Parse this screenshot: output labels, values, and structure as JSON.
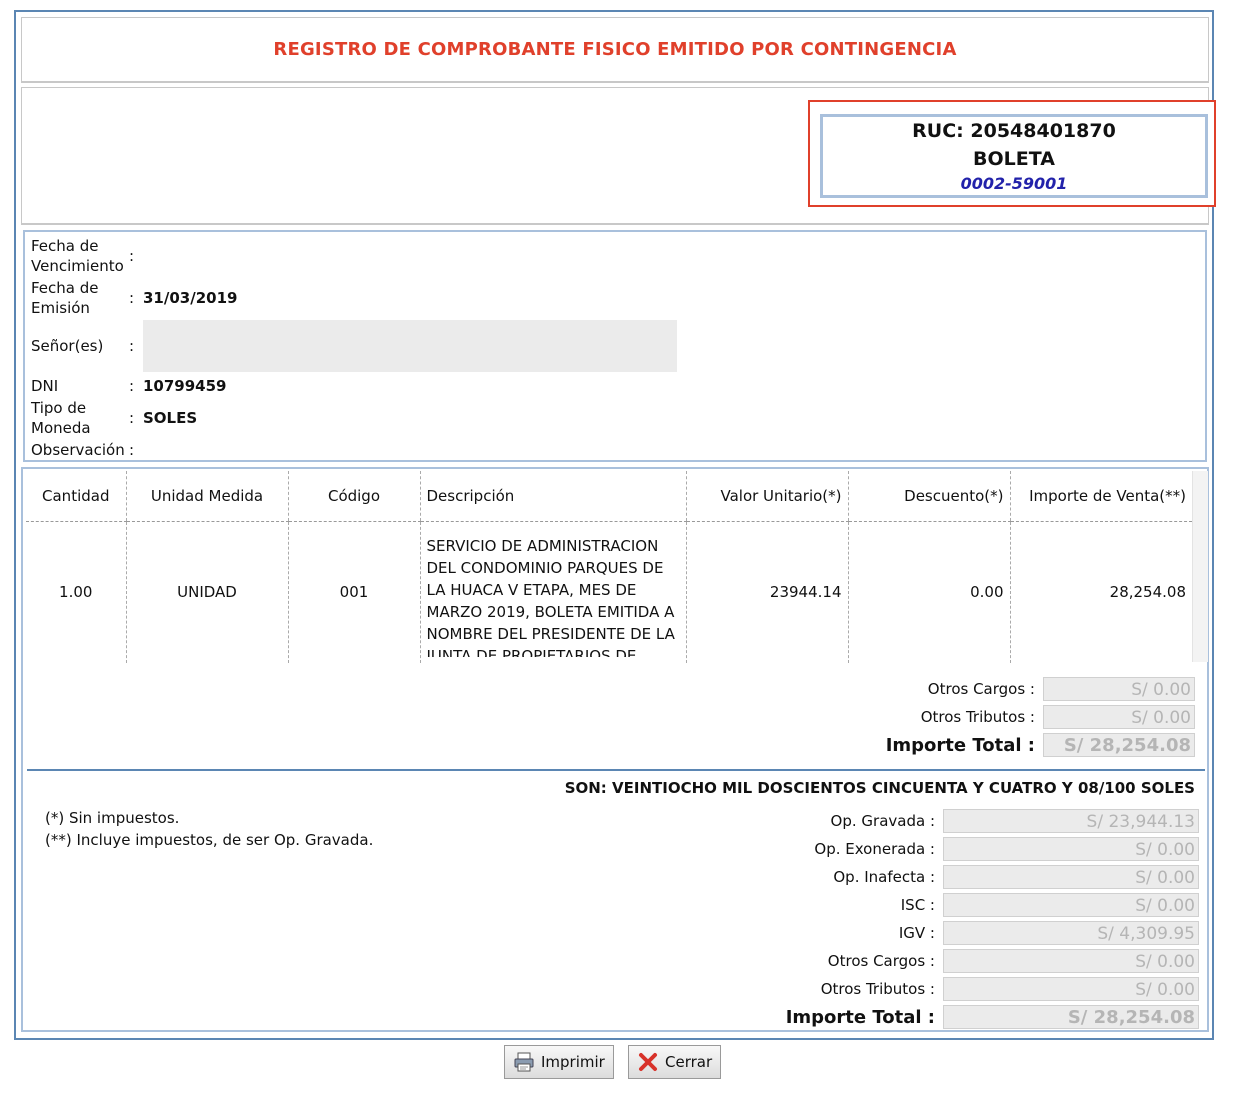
{
  "title": "REGISTRO DE COMPROBANTE FISICO EMITIDO POR CONTINGENCIA",
  "ruc_box": {
    "ruc": "RUC: 20548401870",
    "doc_type": "BOLETA",
    "number": "0002-59001"
  },
  "info": {
    "vencimiento_label": "Fecha de Vencimiento",
    "vencimiento_value": "",
    "emision_label": "Fecha de Emisión",
    "emision_value": "31/03/2019",
    "senor_label": "Señor(es)",
    "dni_label": "DNI",
    "dni_value": "10799459",
    "moneda_label": "Tipo de Moneda",
    "moneda_value": "SOLES",
    "observacion_label": "Observación",
    "colon": ":"
  },
  "table": {
    "headers": [
      "Cantidad",
      "Unidad Medida",
      "Código",
      "Descripción",
      "Valor Unitario(*)",
      "Descuento(*)",
      "Importe de Venta(**)"
    ],
    "rows": [
      {
        "cantidad": "1.00",
        "unidad": "UNIDAD",
        "codigo": "001",
        "descripcion": "SERVICIO DE ADMINISTRACION DEL CONDOMINIO PARQUES DE LA HUACA V ETAPA, MES DE MARZO 2019, BOLETA EMITIDA A NOMBRE DEL PRESIDENTE DE LA JUNTA DE PROPIETARIOS DE PARQUE DE LA HUACA V ETAPA",
        "valor_unitario": "23944.14",
        "descuento": "0.00",
        "importe": "28,254.08"
      }
    ]
  },
  "totals_top": {
    "otros_cargos_label": "Otros Cargos :",
    "otros_cargos_value": "S/ 0.00",
    "otros_tributos_label": "Otros Tributos :",
    "otros_tributos_value": "S/ 0.00",
    "importe_total_label": "Importe Total :",
    "importe_total_value": "S/ 28,254.08"
  },
  "son": "SON: VEINTIOCHO MIL DOSCIENTOS CINCUENTA Y CUATRO Y 08/100 SOLES",
  "notes": {
    "note1": "(*) Sin impuestos.",
    "note2": "(**) Incluye impuestos, de ser Op. Gravada."
  },
  "summary": [
    {
      "label": "Op. Gravada :",
      "value": "S/ 23,944.13"
    },
    {
      "label": "Op. Exonerada :",
      "value": "S/ 0.00"
    },
    {
      "label": "Op. Inafecta :",
      "value": "S/ 0.00"
    },
    {
      "label": "ISC :",
      "value": "S/ 0.00"
    },
    {
      "label": "IGV :",
      "value": "S/ 4,309.95"
    },
    {
      "label": "Otros Cargos :",
      "value": "S/ 0.00"
    },
    {
      "label": "Otros Tributos :",
      "value": "S/ 0.00"
    }
  ],
  "summary_total": {
    "label": "Importe Total :",
    "value": "S/ 28,254.08"
  },
  "buttons": {
    "print_label": "Imprimir",
    "close_label": "Cerrar"
  },
  "icons": {
    "print": "printer-icon",
    "close": "red-x-icon"
  },
  "colors": {
    "title_red": "#e0402b",
    "border_blue": "#5b86b3",
    "light_blue": "#a9c0dc",
    "number_blue": "#2222aa"
  }
}
